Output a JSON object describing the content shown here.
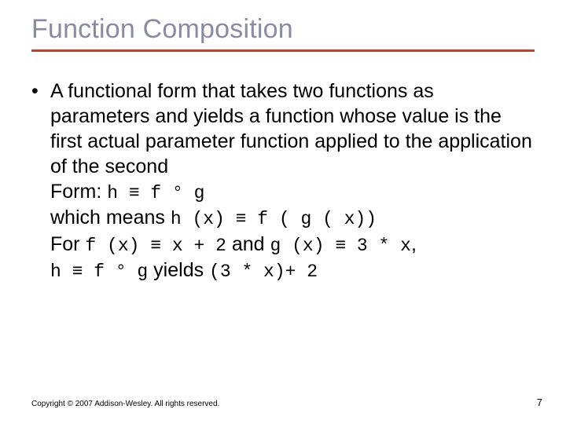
{
  "title": "Function Composition",
  "bullet": {
    "dot": "•",
    "para": "A functional form that takes two functions as parameters and yields a function whose value is the first actual parameter function applied to the application of the second",
    "form_label": "Form: ",
    "form_expr": "h ≡ f ° g",
    "which_means": "which means ",
    "which_means_expr": "h (x) ≡ f ( g ( x))",
    "for_label": "For ",
    "for_f": "f (x) ≡ x + 2",
    "and_label": " and ",
    "for_g": " g (x) ≡ 3 * x",
    "comma": ",",
    "yields_left": "h ≡ f ° g",
    "yields_label": " yields ",
    "yields_right": "(3 * x)+ 2"
  },
  "footer": "Copyright © 2007 Addison-Wesley. All rights reserved.",
  "page_number": "7"
}
